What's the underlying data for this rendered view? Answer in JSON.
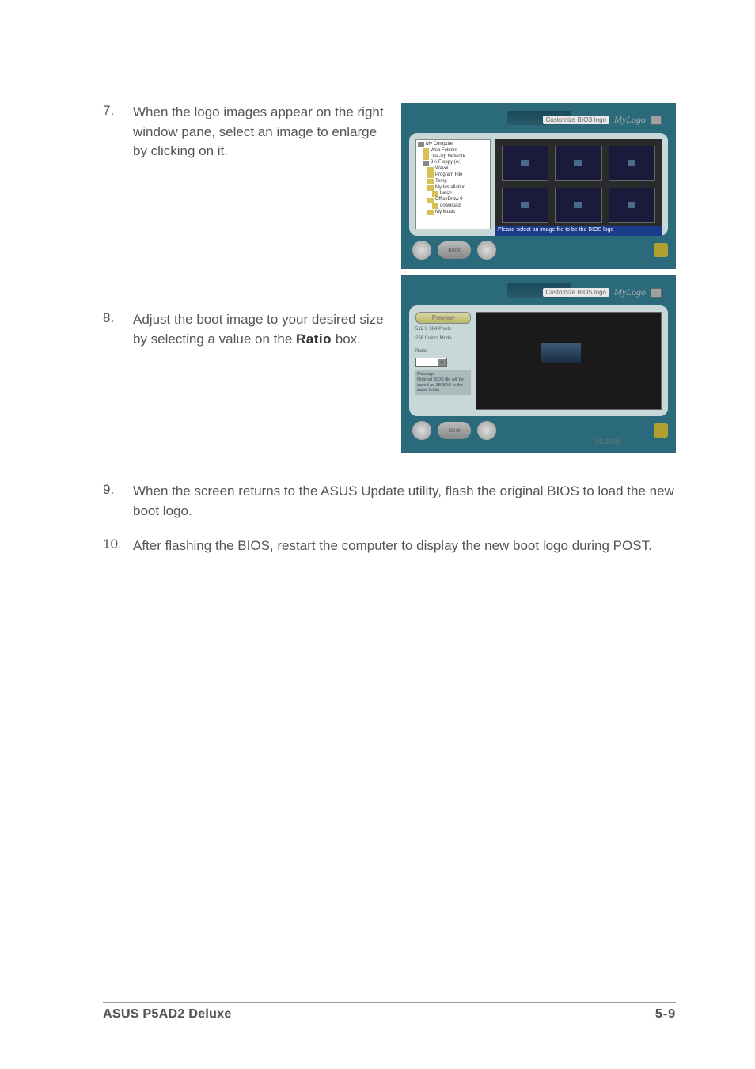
{
  "steps": {
    "s7": {
      "num": "7.",
      "text": "When the logo images appear on the right window pane, select an image to enlarge by clicking on it."
    },
    "s8": {
      "num": "8.",
      "text_before": "Adjust the boot image to your desired size by selecting a value on the ",
      "bold": "Ratio",
      "text_after": " box."
    },
    "s9": {
      "num": "9.",
      "text": "When the screen returns to the ASUS Update utility, flash the original BIOS to load the new boot logo."
    },
    "s10": {
      "num": "10.",
      "text": "After flashing the BIOS, restart the computer to display the new boot logo during POST."
    }
  },
  "screenshot1": {
    "mylogo_tag": "Customize BIOS logo",
    "mylogo": "MyLogo",
    "tree": {
      "i0": "My Computer",
      "i1": "Web Folders",
      "i2": "Dial-Up Network",
      "i3": "3½ Floppy (A:)",
      "i4": "Wavel",
      "i5": "Program File",
      "i6": "Temp",
      "i7": "My Installation",
      "i8": "batch",
      "i9": "OfficeDraw 9",
      "i10": "download",
      "i11": "My Music"
    },
    "status": "Please select an image file to be the BIOS logo",
    "back_btn": "Back"
  },
  "screenshot2": {
    "mylogo_tag": "Customize BIOS logo",
    "mylogo": "MyLogo",
    "preview_label": "Preview",
    "res": "512 X 384 Pixels",
    "mode": "256 Colors Mode",
    "ratio_label": "Ratio",
    "ratio_value": "",
    "msg_title": "Message",
    "msg": "Original BIOS file will be saved as ZB.BAK in the same folder",
    "next_btn": "Next",
    "version": "V3.08.01"
  },
  "footer": {
    "left": "ASUS P5AD2 Deluxe",
    "right": "5-9"
  }
}
